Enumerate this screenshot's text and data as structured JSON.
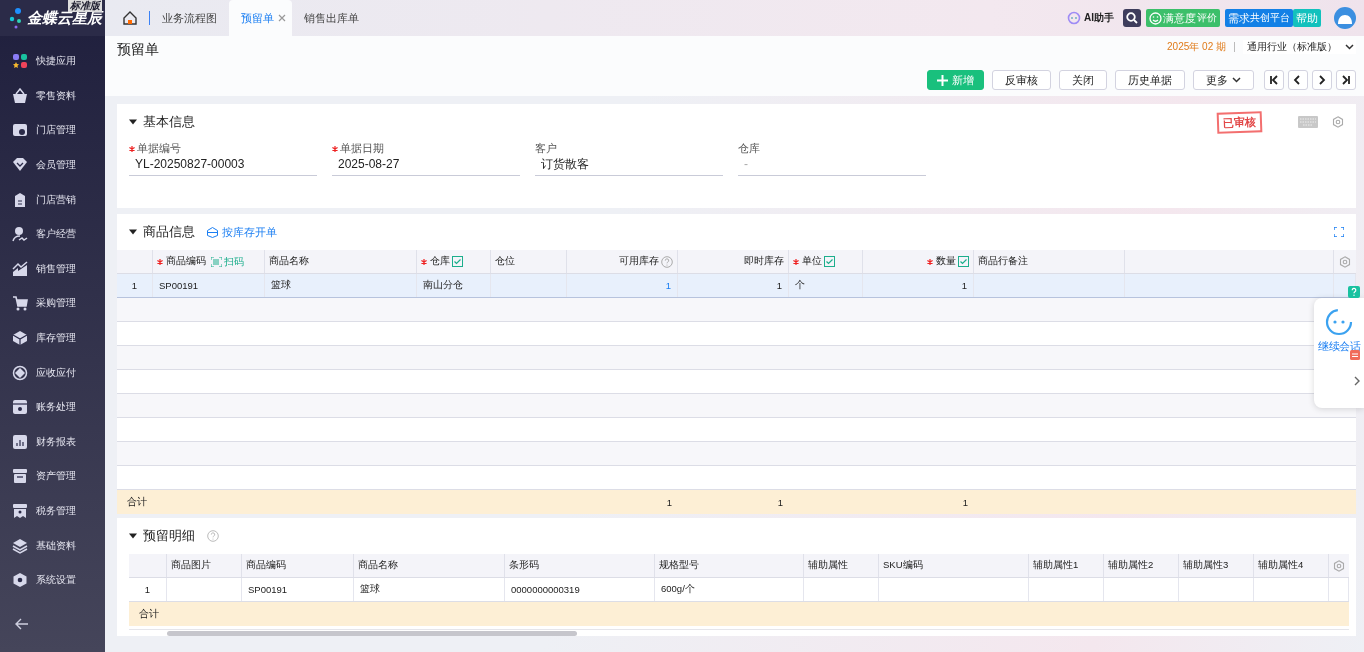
{
  "brand": {
    "name": "金蝶云星辰",
    "edition": "标准版"
  },
  "sidebar": {
    "items": [
      {
        "label": "快捷应用"
      },
      {
        "label": "零售资料"
      },
      {
        "label": "门店管理"
      },
      {
        "label": "会员管理"
      },
      {
        "label": "门店营销"
      },
      {
        "label": "客户经营"
      },
      {
        "label": "销售管理"
      },
      {
        "label": "采购管理"
      },
      {
        "label": "库存管理"
      },
      {
        "label": "应收应付"
      },
      {
        "label": "账务处理"
      },
      {
        "label": "财务报表"
      },
      {
        "label": "资产管理"
      },
      {
        "label": "税务管理"
      },
      {
        "label": "基础资料"
      },
      {
        "label": "系统设置"
      }
    ]
  },
  "tabs": [
    {
      "kind": "home",
      "selected": false
    },
    {
      "label": "业务流程图",
      "selected": false
    },
    {
      "label": "预留单",
      "selected": true,
      "closable": true
    },
    {
      "label": "销售出库单",
      "selected": false
    }
  ],
  "top_actions": {
    "assistant": "AI助手",
    "rating": {
      "main": "满意度",
      "sub": "评价"
    },
    "platform": {
      "main": "需求",
      "sub": "共创平台"
    },
    "help": "帮助"
  },
  "page": {
    "title": "预留单",
    "period": "2025年 02 期",
    "industry": "通用行业（标准版）"
  },
  "toolbar": {
    "buttons": [
      {
        "label": "新增",
        "kind": "primary"
      },
      {
        "label": "反审核",
        "kind": "plain"
      },
      {
        "label": "关闭",
        "kind": "plain"
      },
      {
        "label": "历史单据",
        "kind": "plain"
      },
      {
        "label": "更多",
        "kind": "dropdown"
      }
    ],
    "nav": [
      {
        "kind": "first"
      },
      {
        "kind": "prev"
      },
      {
        "kind": "next"
      },
      {
        "kind": "last"
      }
    ]
  },
  "basic_info": {
    "title": "基本信息",
    "expanded": true,
    "stamp": "已审核",
    "fields": [
      {
        "label": "单据编号",
        "required": true,
        "value": "YL-20250827-00003"
      },
      {
        "label": "单据日期",
        "required": true,
        "value": "2025-08-27"
      },
      {
        "label": "客户",
        "required": false,
        "value": "订货散客"
      },
      {
        "label": "仓库",
        "required": false,
        "value": "-",
        "disabled": true
      }
    ]
  },
  "goods": {
    "title": "商品信息",
    "expanded": true,
    "link": "按库存开单",
    "columns": [
      {},
      {
        "label": "商品编码",
        "required": true,
        "action": "扫码"
      },
      {
        "label": "商品名称"
      },
      {
        "label": "仓库",
        "required": true,
        "tick": true
      },
      {
        "label": "仓位"
      },
      {
        "label": "可用库存",
        "help": true
      },
      {
        "label": "即时库存"
      },
      {
        "label": "单位",
        "required": true,
        "tick": true
      },
      {
        "label": "数量",
        "required": true,
        "tick": true
      },
      {
        "label": "商品行备注"
      },
      {}
    ],
    "rows": [
      {
        "selected": true,
        "cells": [
          "1",
          "SP00191",
          "篮球",
          "南山分仓",
          null,
          "1",
          "1",
          "个",
          "1",
          null,
          null
        ]
      }
    ],
    "total": {
      "label": "合计",
      "cells": [
        null,
        null,
        null,
        null,
        "1",
        "1",
        null,
        "1",
        null,
        null
      ]
    }
  },
  "reserve_detail": {
    "title": "预留明细",
    "expanded": true,
    "columns": [
      {},
      {
        "label": "商品图片"
      },
      {
        "label": "商品编码"
      },
      {
        "label": "商品名称"
      },
      {
        "label": "条形码"
      },
      {
        "label": "规格型号"
      },
      {
        "label": "辅助属性"
      },
      {
        "label": "SKU编码"
      },
      {
        "label": "辅助属性1"
      },
      {
        "label": "辅助属性2"
      },
      {
        "label": "辅助属性3"
      },
      {
        "label": "辅助属性4"
      }
    ],
    "rows": [
      {
        "cells": [
          "1",
          null,
          "SP00191",
          "篮球",
          "0000000000319",
          "600g/个",
          null,
          null,
          null,
          null,
          null,
          null
        ]
      }
    ],
    "total": {
      "label": "合计"
    }
  },
  "chat_widget": {
    "label": "继续会话"
  }
}
